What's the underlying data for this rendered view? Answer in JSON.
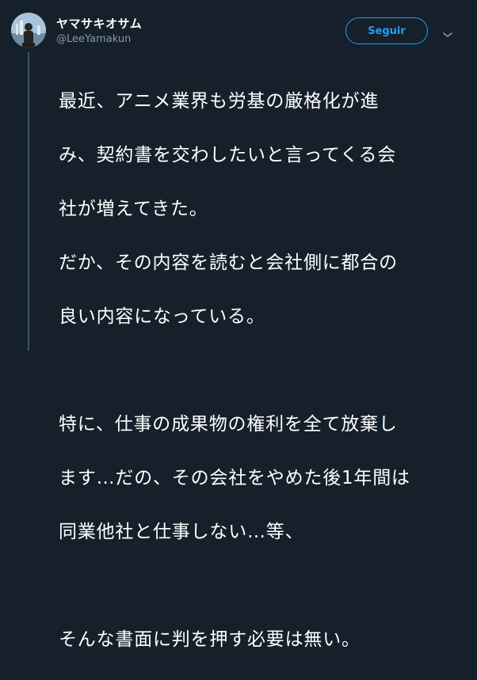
{
  "tweet": {
    "author": {
      "display_name": "ヤマサキオサム",
      "handle": "@LeeYamakun",
      "avatar_icon": "user-avatar"
    },
    "follow_label": "Seguir",
    "menu_icon": "chevron-down-icon",
    "text_lines": [
      "最近、アニメ業界も労基の厳格化が進",
      "み、契約書を交わしたいと言ってくる会",
      "社が増えてきた。",
      "だか、その内容を読むと会社側に都合の",
      "良い内容になっている。",
      "",
      "特に、仕事の成果物の権利を全て放棄し",
      "ます…だの、その会社をやめた後1年間は",
      "同業他社と仕事しない…等、",
      "",
      "そんな書面に判を押す必要は無い。"
    ]
  },
  "colors": {
    "background": "#15202b",
    "accent": "#1da1f2",
    "secondary_text": "#8899a6",
    "thread_line": "#3d5466"
  }
}
